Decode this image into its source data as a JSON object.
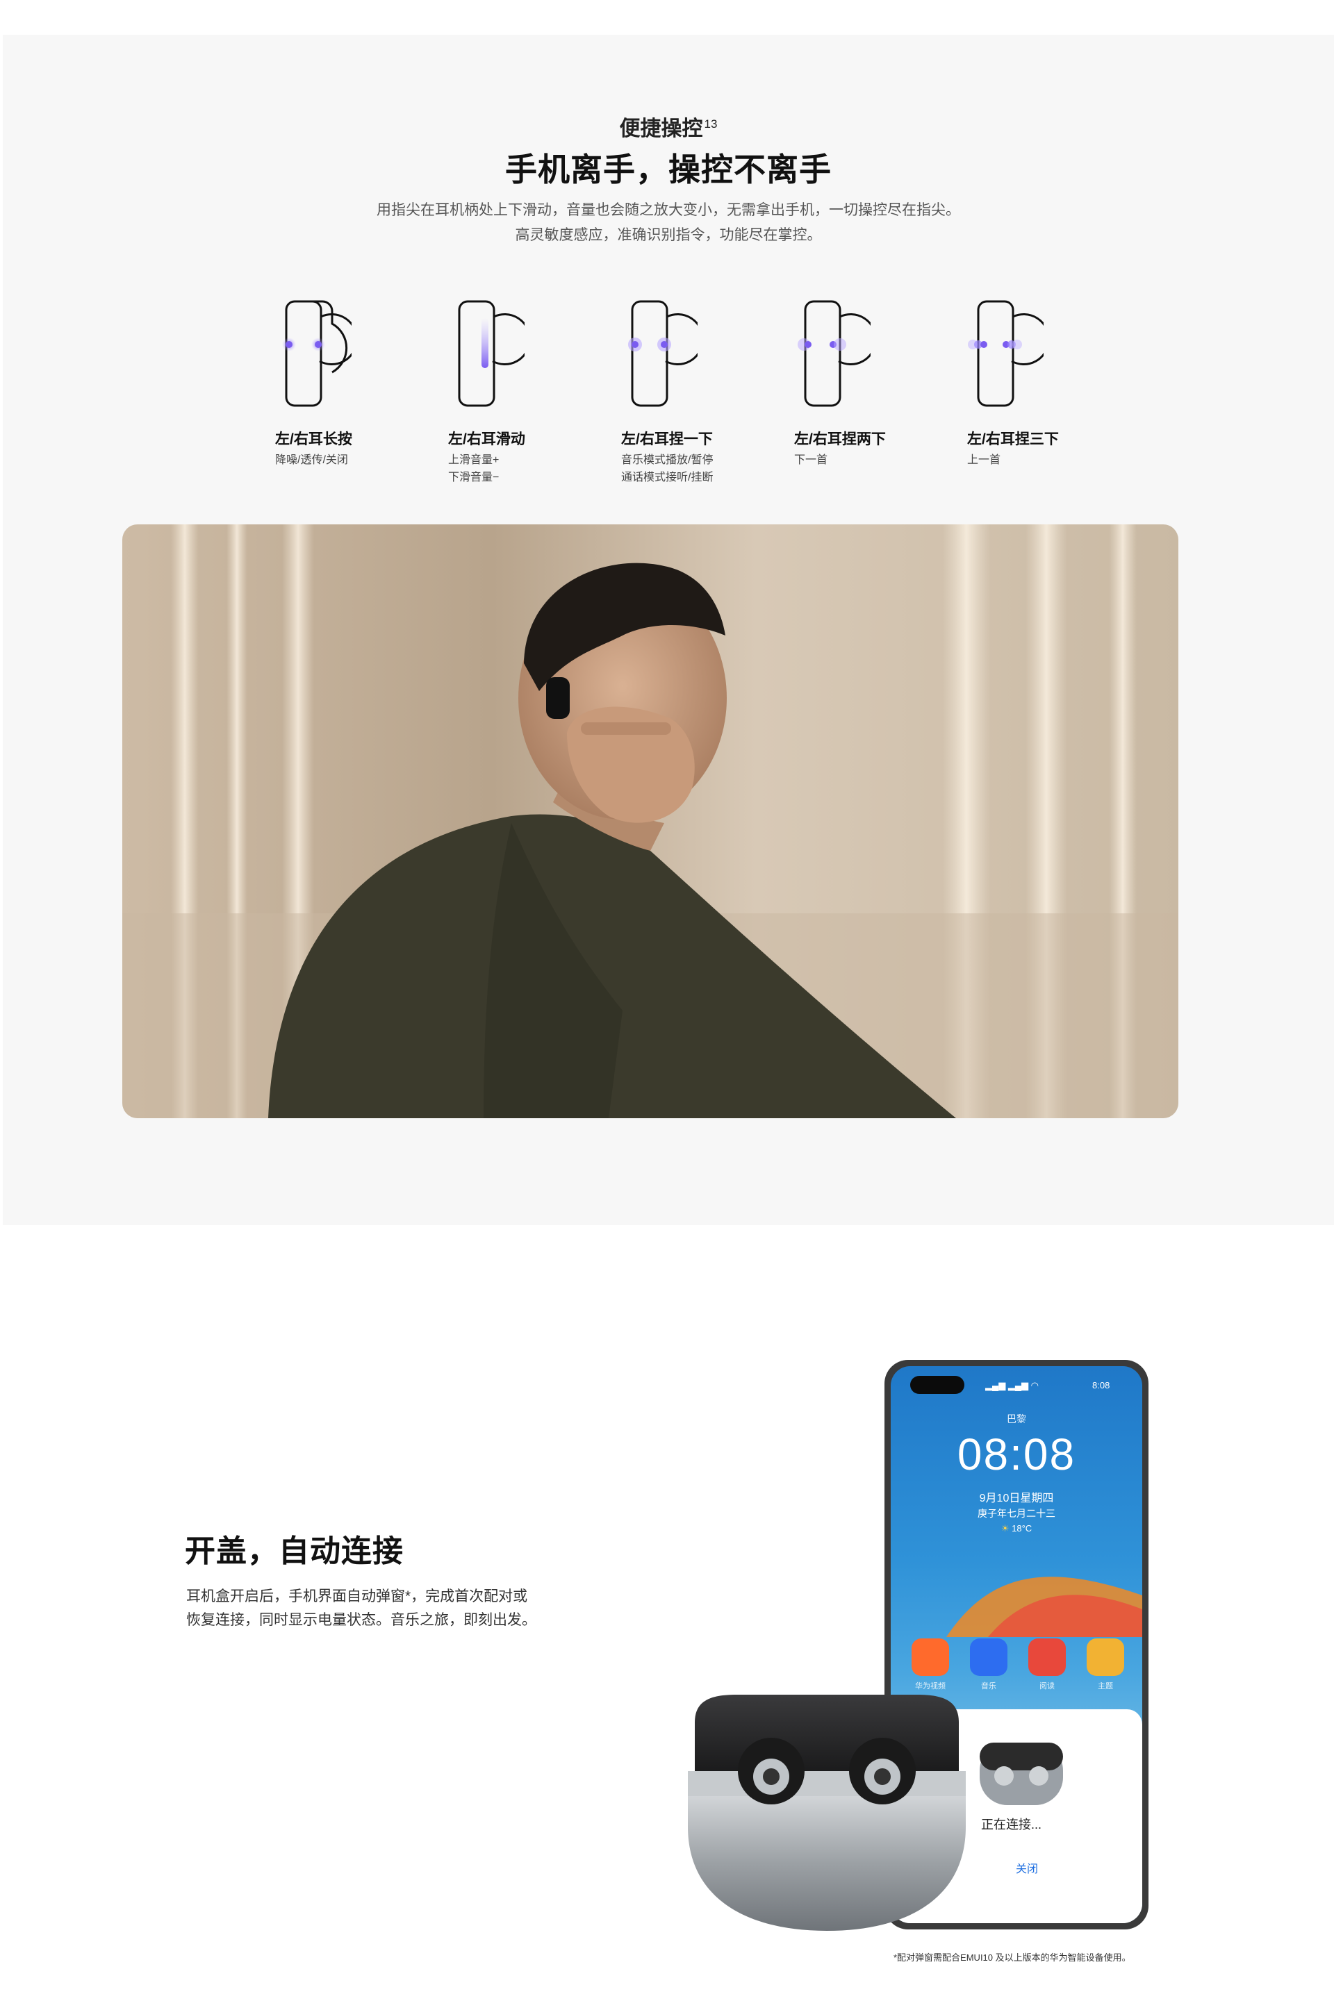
{
  "controls": {
    "eyebrow": "便捷操控",
    "eyebrow_sup": "13",
    "headline": "手机离手，操控不离手",
    "desc_line1": "用指尖在耳机柄处上下滑动，音量也会随之放大变小，无需拿出手机，一切操控尽在指尖。",
    "desc_line2": "高灵敏度感应，准确识别指令，功能尽在掌控。",
    "gestures": [
      {
        "title": "左/右耳长按",
        "desc": [
          "降噪/透传/关闭"
        ]
      },
      {
        "title": "左/右耳滑动",
        "desc": [
          "上滑音量+",
          "下滑音量−"
        ]
      },
      {
        "title": "左/右耳捏一下",
        "desc": [
          "音乐模式播放/暂停",
          "通话模式接听/挂断"
        ]
      },
      {
        "title": "左/右耳捏两下",
        "desc": [
          "下一首"
        ]
      },
      {
        "title": "左/右耳捏三下",
        "desc": [
          "上一首"
        ]
      }
    ]
  },
  "connect": {
    "title": "开盖，自动连接",
    "desc_line1": "耳机盒开启后，手机界面自动弹窗*，完成首次配对或",
    "desc_line2": "恢复连接，同时显示电量状态。音乐之旅，即刻出发。",
    "footnote": "*配对弹窗需配合EMUI10 及以上版本的华为智能设备使用。"
  },
  "phone": {
    "location": "巴黎",
    "time": "08:08",
    "date": "9月10日星期四",
    "lunar": "庚子年七月二十三",
    "temperature": "18°C",
    "status_time": "8:08",
    "apps": [
      "华为视频",
      "音乐",
      "阅读",
      "主题"
    ],
    "popup_status": "正在连接...",
    "popup_close": "关闭"
  },
  "colors": {
    "section_bg": "#f7f7f7",
    "gesture_accent": "#8a6cf0",
    "link_blue": "#1f6fe0"
  },
  "icons": {
    "gesture": "earbud-gesture-icon"
  }
}
